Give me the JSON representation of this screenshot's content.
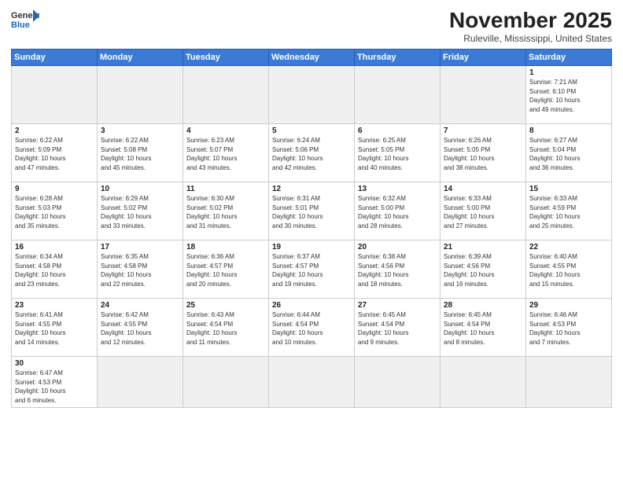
{
  "logo": {
    "line1": "General",
    "line2": "Blue"
  },
  "title": "November 2025",
  "subtitle": "Ruleville, Mississippi, United States",
  "days_header": [
    "Sunday",
    "Monday",
    "Tuesday",
    "Wednesday",
    "Thursday",
    "Friday",
    "Saturday"
  ],
  "weeks": [
    [
      {
        "num": "",
        "info": ""
      },
      {
        "num": "",
        "info": ""
      },
      {
        "num": "",
        "info": ""
      },
      {
        "num": "",
        "info": ""
      },
      {
        "num": "",
        "info": ""
      },
      {
        "num": "",
        "info": ""
      },
      {
        "num": "1",
        "info": "Sunrise: 7:21 AM\nSunset: 6:10 PM\nDaylight: 10 hours\nand 49 minutes."
      }
    ],
    [
      {
        "num": "2",
        "info": "Sunrise: 6:22 AM\nSunset: 5:09 PM\nDaylight: 10 hours\nand 47 minutes."
      },
      {
        "num": "3",
        "info": "Sunrise: 6:22 AM\nSunset: 5:08 PM\nDaylight: 10 hours\nand 45 minutes."
      },
      {
        "num": "4",
        "info": "Sunrise: 6:23 AM\nSunset: 5:07 PM\nDaylight: 10 hours\nand 43 minutes."
      },
      {
        "num": "5",
        "info": "Sunrise: 6:24 AM\nSunset: 5:06 PM\nDaylight: 10 hours\nand 42 minutes."
      },
      {
        "num": "6",
        "info": "Sunrise: 6:25 AM\nSunset: 5:05 PM\nDaylight: 10 hours\nand 40 minutes."
      },
      {
        "num": "7",
        "info": "Sunrise: 6:26 AM\nSunset: 5:05 PM\nDaylight: 10 hours\nand 38 minutes."
      },
      {
        "num": "8",
        "info": "Sunrise: 6:27 AM\nSunset: 5:04 PM\nDaylight: 10 hours\nand 36 minutes."
      }
    ],
    [
      {
        "num": "9",
        "info": "Sunrise: 6:28 AM\nSunset: 5:03 PM\nDaylight: 10 hours\nand 35 minutes."
      },
      {
        "num": "10",
        "info": "Sunrise: 6:29 AM\nSunset: 5:02 PM\nDaylight: 10 hours\nand 33 minutes."
      },
      {
        "num": "11",
        "info": "Sunrise: 6:30 AM\nSunset: 5:02 PM\nDaylight: 10 hours\nand 31 minutes."
      },
      {
        "num": "12",
        "info": "Sunrise: 6:31 AM\nSunset: 5:01 PM\nDaylight: 10 hours\nand 30 minutes."
      },
      {
        "num": "13",
        "info": "Sunrise: 6:32 AM\nSunset: 5:00 PM\nDaylight: 10 hours\nand 28 minutes."
      },
      {
        "num": "14",
        "info": "Sunrise: 6:33 AM\nSunset: 5:00 PM\nDaylight: 10 hours\nand 27 minutes."
      },
      {
        "num": "15",
        "info": "Sunrise: 6:33 AM\nSunset: 4:59 PM\nDaylight: 10 hours\nand 25 minutes."
      }
    ],
    [
      {
        "num": "16",
        "info": "Sunrise: 6:34 AM\nSunset: 4:58 PM\nDaylight: 10 hours\nand 23 minutes."
      },
      {
        "num": "17",
        "info": "Sunrise: 6:35 AM\nSunset: 4:58 PM\nDaylight: 10 hours\nand 22 minutes."
      },
      {
        "num": "18",
        "info": "Sunrise: 6:36 AM\nSunset: 4:57 PM\nDaylight: 10 hours\nand 20 minutes."
      },
      {
        "num": "19",
        "info": "Sunrise: 6:37 AM\nSunset: 4:57 PM\nDaylight: 10 hours\nand 19 minutes."
      },
      {
        "num": "20",
        "info": "Sunrise: 6:38 AM\nSunset: 4:56 PM\nDaylight: 10 hours\nand 18 minutes."
      },
      {
        "num": "21",
        "info": "Sunrise: 6:39 AM\nSunset: 4:56 PM\nDaylight: 10 hours\nand 16 minutes."
      },
      {
        "num": "22",
        "info": "Sunrise: 6:40 AM\nSunset: 4:55 PM\nDaylight: 10 hours\nand 15 minutes."
      }
    ],
    [
      {
        "num": "23",
        "info": "Sunrise: 6:41 AM\nSunset: 4:55 PM\nDaylight: 10 hours\nand 14 minutes."
      },
      {
        "num": "24",
        "info": "Sunrise: 6:42 AM\nSunset: 4:55 PM\nDaylight: 10 hours\nand 12 minutes."
      },
      {
        "num": "25",
        "info": "Sunrise: 6:43 AM\nSunset: 4:54 PM\nDaylight: 10 hours\nand 11 minutes."
      },
      {
        "num": "26",
        "info": "Sunrise: 6:44 AM\nSunset: 4:54 PM\nDaylight: 10 hours\nand 10 minutes."
      },
      {
        "num": "27",
        "info": "Sunrise: 6:45 AM\nSunset: 4:54 PM\nDaylight: 10 hours\nand 9 minutes."
      },
      {
        "num": "28",
        "info": "Sunrise: 6:45 AM\nSunset: 4:54 PM\nDaylight: 10 hours\nand 8 minutes."
      },
      {
        "num": "29",
        "info": "Sunrise: 6:46 AM\nSunset: 4:53 PM\nDaylight: 10 hours\nand 7 minutes."
      }
    ],
    [
      {
        "num": "30",
        "info": "Sunrise: 6:47 AM\nSunset: 4:53 PM\nDaylight: 10 hours\nand 6 minutes."
      },
      {
        "num": "",
        "info": ""
      },
      {
        "num": "",
        "info": ""
      },
      {
        "num": "",
        "info": ""
      },
      {
        "num": "",
        "info": ""
      },
      {
        "num": "",
        "info": ""
      },
      {
        "num": "",
        "info": ""
      }
    ]
  ]
}
